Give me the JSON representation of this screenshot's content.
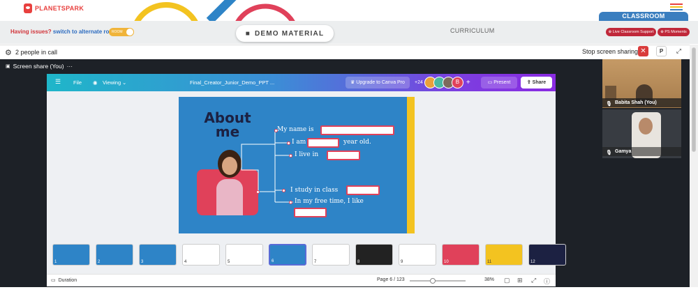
{
  "header": {
    "brand": "PLANETSPARK",
    "classroom_tab": "CLASSROOM",
    "colors": {
      "brand_red": "#e8403e",
      "classroom_blue": "#3a7ebf"
    }
  },
  "toolbar": {
    "issue_text": "Having issues?",
    "issue_link": "switch to alternate room",
    "toggle_label": "ROOM",
    "demo_material": "DEMO MATERIAL",
    "curriculum": "CURRICULUM",
    "live_support": "Live Classroom Support",
    "ps_moments": "PS Moments"
  },
  "call": {
    "people": "2 people in call",
    "stop_sharing": "Stop screen sharing",
    "p_button": "P",
    "screen_share_label": "Screen share (You)",
    "more": "···"
  },
  "canva": {
    "file": "File",
    "viewing": "Viewing",
    "doc_title": "Final_Creator_Junior_Demo_PPT ...",
    "upgrade": "Upgrade to Canva Pro",
    "collab_count": "+24",
    "avatar_letter": "B",
    "present": "Present",
    "share": "Share",
    "duration": "Duration",
    "page": "Page 6 / 123",
    "zoom": "38%",
    "zoom_value": 0.38
  },
  "slide": {
    "title_line1": "About",
    "title_line2": "me",
    "line_name": "My name is",
    "line_age_a": "I am",
    "line_age_b": "year old.",
    "line_live": "I live in",
    "line_study": "I study in class",
    "line_free": "In my free time, I like"
  },
  "thumbnails": [
    {
      "n": "1",
      "bg": "#2e84c7"
    },
    {
      "n": "2",
      "bg": "#2e84c7"
    },
    {
      "n": "3",
      "bg": "#2e84c7"
    },
    {
      "n": "4",
      "bg": "#ffffff"
    },
    {
      "n": "5",
      "bg": "#ffffff"
    },
    {
      "n": "6",
      "bg": "#2e84c7"
    },
    {
      "n": "7",
      "bg": "#ffffff"
    },
    {
      "n": "8",
      "bg": "#222222"
    },
    {
      "n": "9",
      "bg": "#ffffff"
    },
    {
      "n": "10",
      "bg": "#e0415a"
    },
    {
      "n": "11",
      "bg": "#f3c320"
    },
    {
      "n": "12",
      "bg": "#1c2142"
    }
  ],
  "participants": [
    {
      "name": "Babita Shah (You)"
    },
    {
      "name": "Gamya"
    }
  ]
}
